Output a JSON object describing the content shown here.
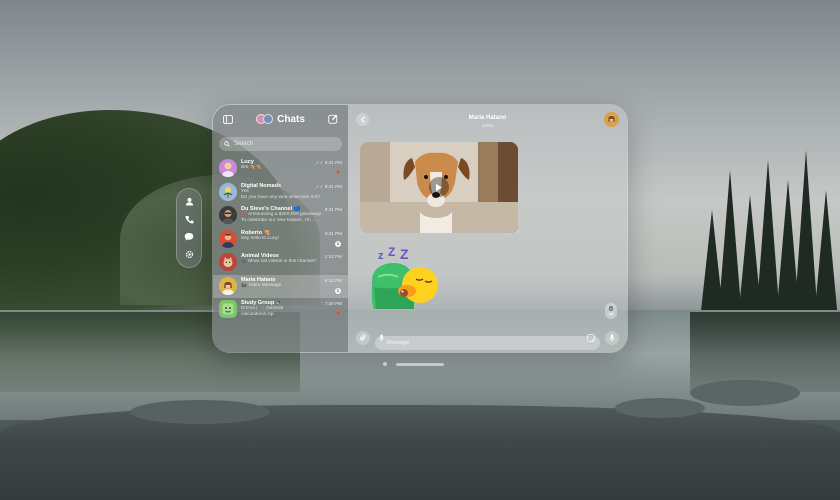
{
  "sidebar": {
    "title": "Chats",
    "search_placeholder": "Search",
    "chats": [
      {
        "name": "Lucy",
        "message": "Brb 🍕🍕",
        "time": "9:41 PM",
        "read": true,
        "pinned": true,
        "avatar_color": "#c98bd6"
      },
      {
        "name": "Digital Nomads",
        "message_line1": "Yes",
        "message_line2": "Do you have any idea what time it is?",
        "time": "9:41 PM",
        "read": true,
        "avatar_color": "#9bb8d9"
      },
      {
        "name": "Du Steve's Channel 🔵",
        "message_line1": "📣 Announcing a $250,000 giveaway!",
        "message_line2": "To celebrate our new feature, I'm ...",
        "time": "9:41 PM",
        "avatar_color": "#3b3b3b"
      },
      {
        "name": "Roberto 🍕",
        "message": "Say hello to Lucy!",
        "time": "9:41 PM",
        "unread": "1",
        "avatar_color": "#d84d3a"
      },
      {
        "name": "Animal Videos",
        "message": "📹 Moar cat videos in this channel?",
        "time": "2:22 PM",
        "avatar_color": "#b9463a"
      },
      {
        "name": "Maria Hatano",
        "message": "🎬 Video Message",
        "time": "6:12 PM",
        "unread": "1",
        "avatar_color": "#e3b24d",
        "active": true
      },
      {
        "name": "Study Group 🔈",
        "message_line1": "Emma | 📎 General",
        "message_line2": "calculations.zip",
        "time": "7:38 PM",
        "avatar_color": "#7fc46a"
      }
    ]
  },
  "conversation": {
    "title": "Maria Hatano",
    "status": "online",
    "composer_placeholder": "Message",
    "scroll_badge": "1"
  },
  "icons": {
    "sidebar_toggle": "sidebar-toggle-icon",
    "compose": "compose-icon",
    "search": "search-icon",
    "back": "chevron-left-icon",
    "play": "play-icon",
    "attach": "paperclip-icon",
    "mic": "microphone-icon",
    "sticker": "sticker-icon",
    "ornament": [
      "person-icon",
      "phone-icon",
      "chat-bubble-icon",
      "gear-icon"
    ]
  }
}
